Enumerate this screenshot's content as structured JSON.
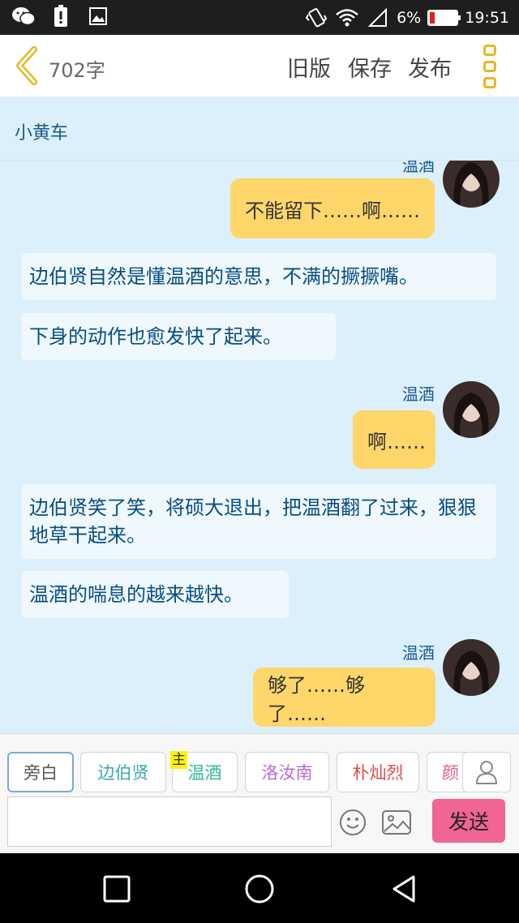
{
  "status_bar": {
    "battery": "6%",
    "time": "19:51",
    "icons": [
      "wechat-icon",
      "battery-alert-icon",
      "gallery-icon",
      "vibrate-icon",
      "wifi-icon",
      "signal-icon",
      "battery-icon"
    ]
  },
  "header": {
    "word_count": "702字",
    "old_version": "旧版",
    "save": "保存",
    "publish": "发布"
  },
  "chat": {
    "title": "小黄车",
    "top_speaker_partial": "温酒",
    "messages": [
      {
        "type": "right",
        "speaker": "",
        "text": "不能留下……啊……"
      },
      {
        "type": "narration",
        "text": "边伯贤自然是懂温酒的意思，不满的撅撅嘴。"
      },
      {
        "type": "narration",
        "text": "下身的动作也愈发快了起来。"
      },
      {
        "type": "right",
        "speaker": "温酒",
        "text": "啊……"
      },
      {
        "type": "narration",
        "text": "边伯贤笑了笑，将硕大退出，把温酒翻了过来，狠狠地草干起来。"
      },
      {
        "type": "narration",
        "text": "温酒的喘息的越来越快。"
      },
      {
        "type": "right",
        "speaker": "温酒",
        "text": "够了……够了……"
      }
    ]
  },
  "roles": {
    "items": [
      {
        "label": "旁白",
        "color": "#555555"
      },
      {
        "label": "边伯贤",
        "color": "#3aa6b5"
      },
      {
        "label": "温酒",
        "color": "#2fb8a0",
        "tag": "主"
      },
      {
        "label": "洛汝南",
        "color": "#b76ad9"
      },
      {
        "label": "朴灿烈",
        "color": "#d94a4a"
      },
      {
        "label": "颜",
        "color": "#e0638a"
      }
    ],
    "send": "发送",
    "input_value": ""
  },
  "colors": {
    "bubble": "#ffd66a",
    "chat_bg": "#dcf0fb",
    "send_button": "#f06592"
  }
}
